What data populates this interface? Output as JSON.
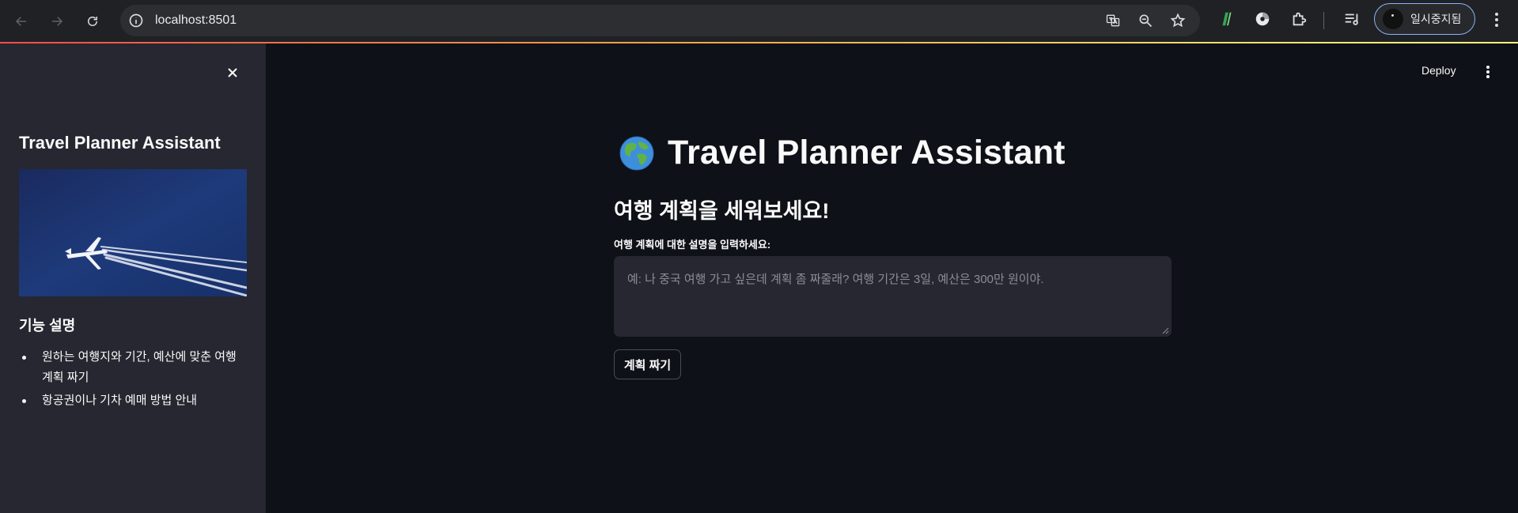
{
  "browser": {
    "url": "localhost:8501",
    "profile_label": "일시중지됨"
  },
  "sidebar": {
    "title": "Travel Planner Assistant",
    "image_alt": "airplane",
    "features_heading": "기능 설명",
    "features": [
      "원하는 여행지와 기간, 예산에 맞춘 여행 계획 짜기",
      "항공권이나 기차 예매 방법 안내"
    ]
  },
  "header": {
    "deploy_label": "Deploy"
  },
  "main": {
    "title": "Travel Planner Assistant",
    "title_icon": "globe-icon",
    "subheader": "여행 계획을 세워보세요!",
    "input_label": "여행 계획에 대한 설명을 입력하세요:",
    "input_value": "",
    "input_placeholder": "예: 나 중국 여행 가고 싶은데 계획 좀 짜줄래? 여행 기간은 3일, 예산은 300만 원이야.",
    "button_label": "계획 짜기"
  },
  "colors": {
    "background": "#0e1117",
    "sidebar": "#262730",
    "accent": "#ff4b4b"
  }
}
